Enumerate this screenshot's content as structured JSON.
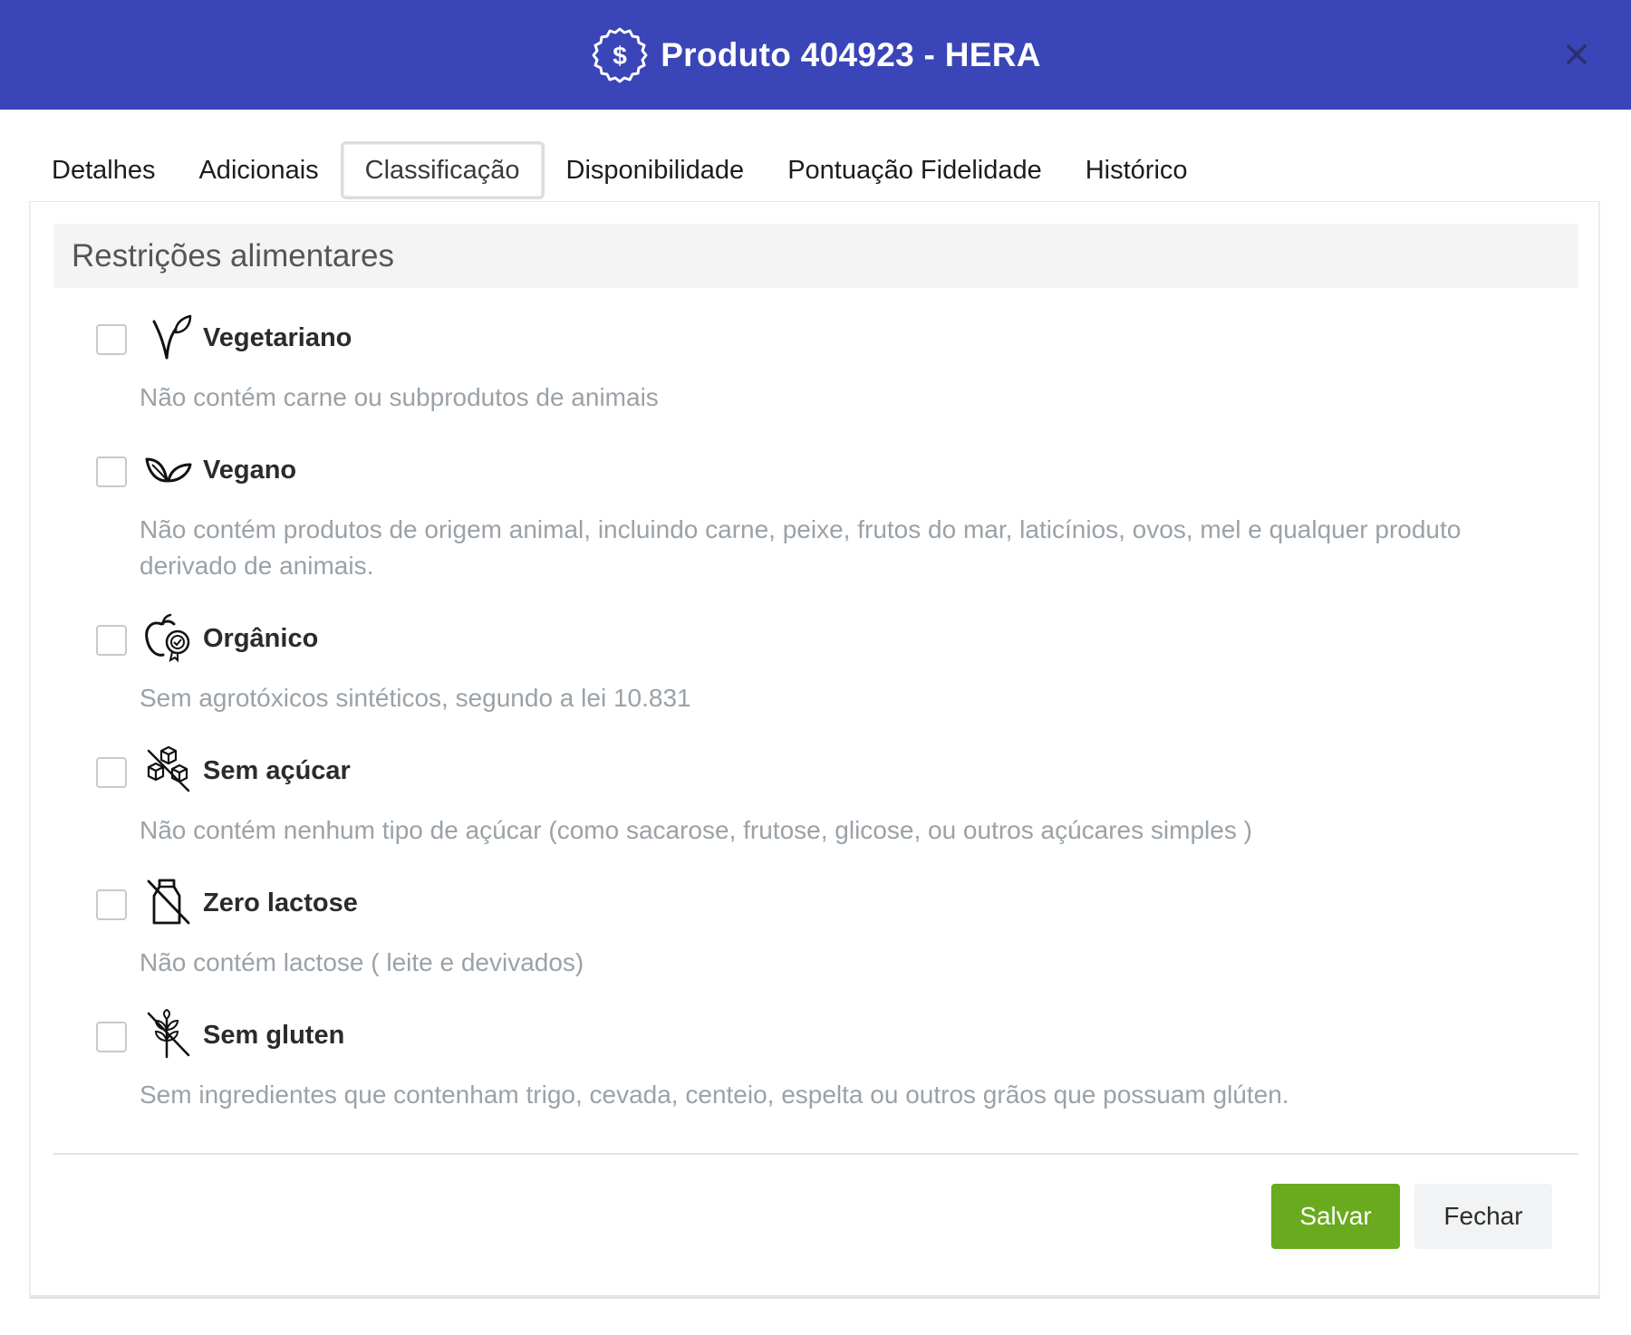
{
  "header": {
    "title": "Produto 404923 - HERA",
    "icon": "dollar-badge-icon",
    "close_icon": "close-icon",
    "bg_color": "#3a45b8"
  },
  "tabs": [
    {
      "label": "Detalhes",
      "active": false
    },
    {
      "label": "Adicionais",
      "active": false
    },
    {
      "label": "Classificação",
      "active": true
    },
    {
      "label": "Disponibilidade",
      "active": false
    },
    {
      "label": "Pontuação Fidelidade",
      "active": false
    },
    {
      "label": "Histórico",
      "active": false
    }
  ],
  "section": {
    "title": "Restrições alimentares"
  },
  "options": [
    {
      "label": "Vegetariano",
      "description": "Não contém carne ou subprodutos de animais",
      "icon": "sprout-icon",
      "checked": false
    },
    {
      "label": "Vegano",
      "description": "Não contém produtos de origem animal, incluindo carne, peixe, frutos do mar, laticínios, ovos, mel e qualquer produto derivado de animais.",
      "icon": "leaves-icon",
      "checked": false
    },
    {
      "label": "Orgânico",
      "description": "Sem agrotóxicos sintéticos, segundo a lei 10.831",
      "icon": "organic-apple-icon",
      "checked": false
    },
    {
      "label": "Sem açúcar",
      "description": "Não contém nenhum tipo de açúcar (como sacarose, frutose, glicose, ou outros açúcares simples )",
      "icon": "no-sugar-icon",
      "checked": false
    },
    {
      "label": "Zero lactose",
      "description": "Não contém lactose ( leite e devivados)",
      "icon": "no-milk-icon",
      "checked": false
    },
    {
      "label": "Sem gluten",
      "description": "Sem ingredientes que contenham trigo, cevada, centeio, espelta ou outros grãos que possuam glúten.",
      "icon": "no-gluten-icon",
      "checked": false
    }
  ],
  "footer": {
    "save_label": "Salvar",
    "close_label": "Fechar",
    "save_color": "#6aaa1e"
  }
}
